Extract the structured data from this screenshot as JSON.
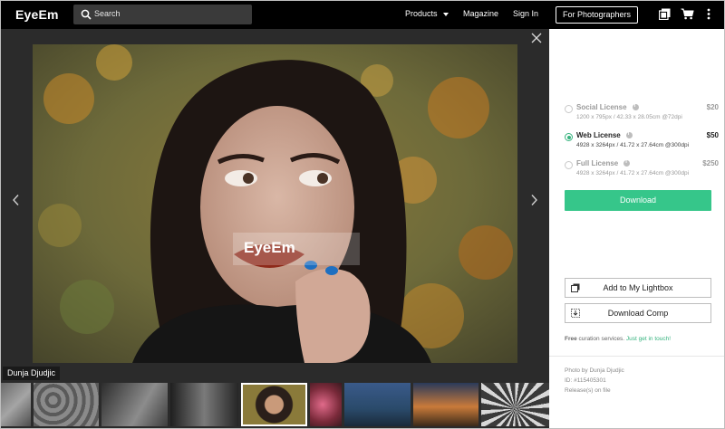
{
  "header": {
    "logo": "EyeEm",
    "search_placeholder": "Search",
    "nav": {
      "products": "Products",
      "magazine": "Magazine",
      "signin": "Sign In"
    },
    "cta": "For Photographers",
    "icons": [
      "lightbox-icon",
      "cart-icon",
      "more-vertical-icon"
    ]
  },
  "viewer": {
    "watermark": "EyeEm",
    "photographer_tag": "Dunja Djudjic",
    "icons": [
      "close-icon",
      "chevron-left-icon",
      "chevron-right-icon"
    ]
  },
  "licenses": [
    {
      "name": "Social License",
      "price": "$20",
      "spec": "1200 x 795px / 42.33 x 28.05cm @72dpi",
      "selected": false
    },
    {
      "name": "Web License",
      "price": "$50",
      "spec": "4928 x 3264px / 41.72 x 27.64cm @300dpi",
      "selected": true
    },
    {
      "name": "Full License",
      "price": "$250",
      "spec": "4928 x 3264px / 41.72 x 27.64cm @300dpi",
      "selected": false
    }
  ],
  "actions": {
    "download": "Download",
    "lightbox": "Add to My Lightbox",
    "comp": "Download Comp"
  },
  "curation": {
    "lead": "Free",
    "text": " curation services. ",
    "link": "Just get in touch!"
  },
  "meta": {
    "photo_by": "Photo by Dunja Djudjic",
    "id": "ID: #115405301",
    "release": "Release(s) on file"
  },
  "colors": {
    "accent": "#36c68a",
    "topbar": "#000000",
    "viewer_bg": "#2b2b2b"
  }
}
